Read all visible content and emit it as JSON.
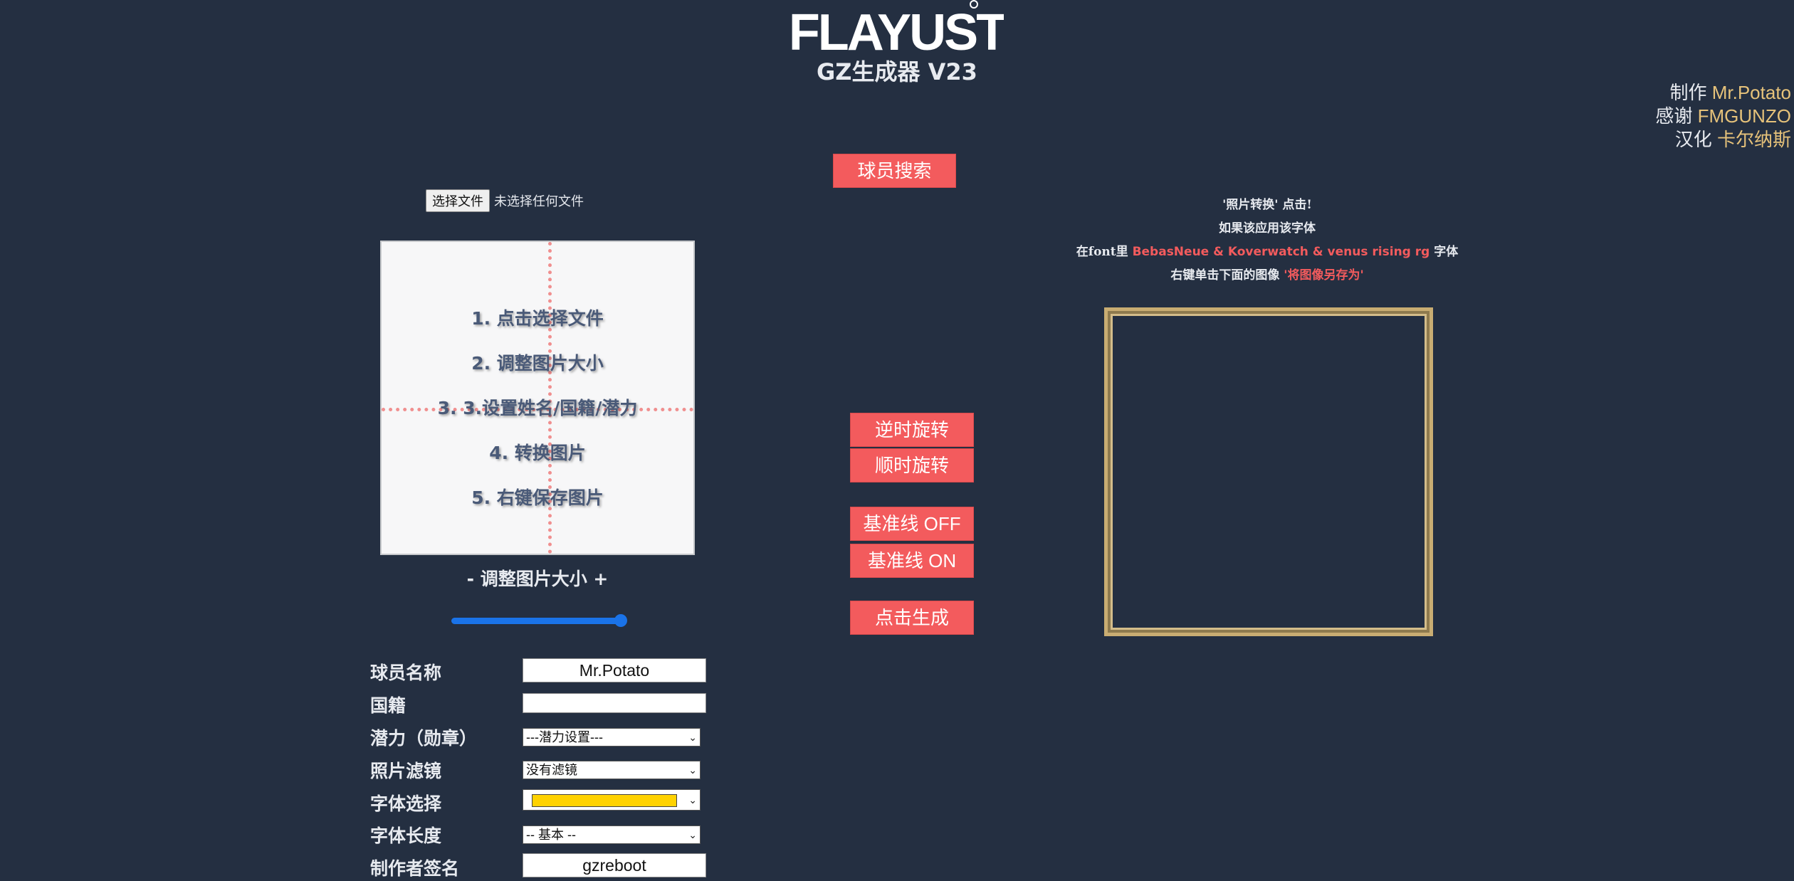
{
  "header": {
    "logo_text": "FLAYUST",
    "app_title": "GZ生成器 V23"
  },
  "credits": [
    {
      "label": "制作",
      "name": "Mr.Potato"
    },
    {
      "label": "感谢",
      "name": "FMGUNZO"
    },
    {
      "label": "汉化",
      "name": "卡尔纳斯"
    }
  ],
  "buttons": {
    "player_search": "球员搜索",
    "rotate_ccw": "逆时旋转",
    "rotate_cw": "顺时旋转",
    "guides_off": "基准线 OFF",
    "guides_on": "基准线 ON",
    "generate": "点击生成"
  },
  "file_picker": {
    "button_label": "选择文件",
    "status": "未选择任何文件"
  },
  "crop_box": {
    "steps": [
      "1. 点击选择文件",
      "2. 调整图片大小",
      "3. 3.设置姓名/国籍/潜力",
      "4. 转换图片",
      "5. 右键保存图片"
    ]
  },
  "resize": {
    "label": "- 调整图片大小 +",
    "value_fraction": 1.0
  },
  "form": {
    "player_name": {
      "label": "球员名称",
      "value": "Mr.Potato"
    },
    "nationality": {
      "label": "国籍",
      "value": ""
    },
    "potential": {
      "label": "潜力（勋章）",
      "selected": "---潜力设置---"
    },
    "photo_filter": {
      "label": "照片滤镜",
      "selected": "没有滤镜"
    },
    "font_select": {
      "label": "字体选择",
      "swatch_color": "#ffd200"
    },
    "font_length": {
      "label": "字体长度",
      "selected": "-- 基本 --"
    },
    "author_signature": {
      "label": "制作者签名",
      "value": "gzreboot"
    }
  },
  "instructions": {
    "line1": "'照片转换' 点击!",
    "line2": "如果该应用该字体",
    "line3_prefix": "在font里 ",
    "line3_fonts": "BebasNeue & Koverwatch & venus rising rg",
    "line3_suffix": " 字体",
    "line4_prefix": "右键单击下面的图像 ",
    "line4_action": "'将图像另存为'"
  },
  "colors": {
    "background": "#242f41",
    "accent_red": "#f35b5d",
    "credit_gold": "#e6c27a",
    "frame_gold": "#c9ad72",
    "slider_blue": "#1a73e8"
  }
}
